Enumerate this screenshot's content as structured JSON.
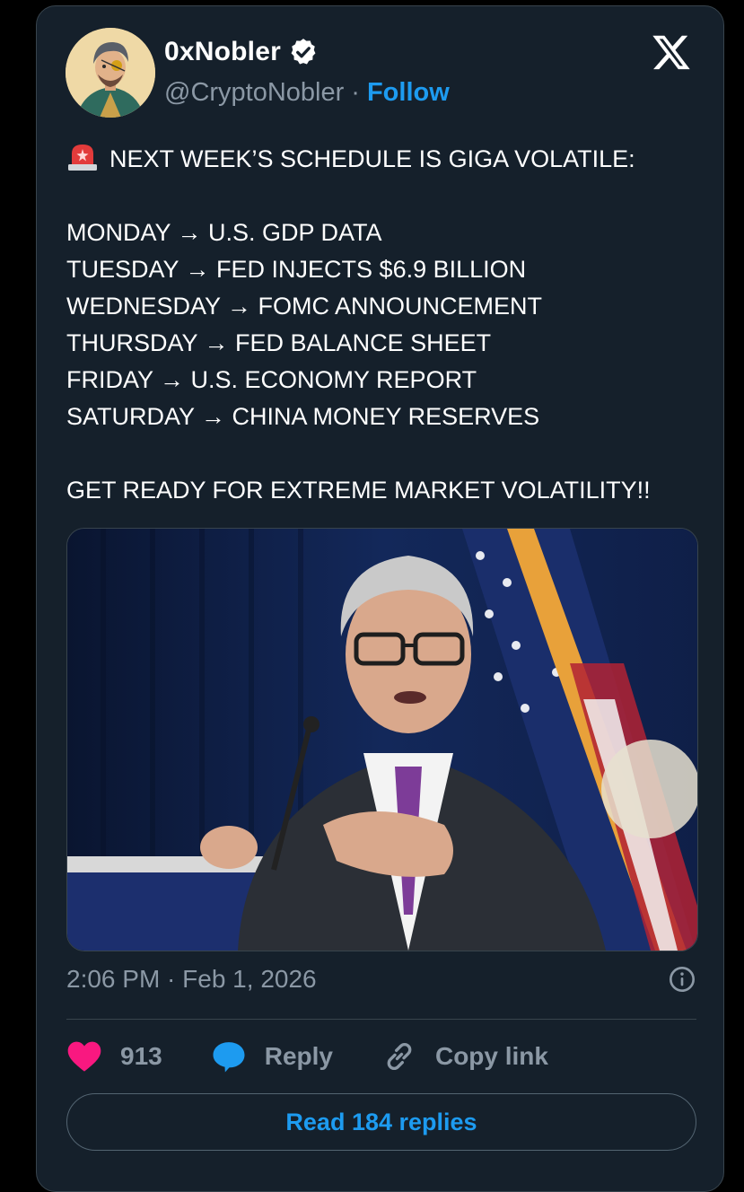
{
  "author": {
    "display_name": "0xNobler",
    "handle": "@CryptoNobler",
    "separator": "·",
    "follow_label": "Follow",
    "verified": true
  },
  "tweet": {
    "headline": "NEXT WEEK’S SCHEDULE IS GIGA VOLATILE:",
    "schedule": [
      "MONDAY → U.S. GDP DATA",
      "TUESDAY → FED INJECTS $6.9 BILLION",
      "WEDNESDAY → FOMC ANNOUNCEMENT",
      "THURSDAY → FED BALANCE SHEET",
      "FRIDAY → U.S. ECONOMY REPORT",
      "SATURDAY → CHINA MONEY RESERVES"
    ],
    "closing": "GET READY FOR EXTREME MARKET VOLATILITY!!",
    "timestamp": "2:06 PM · Feb 1, 2026"
  },
  "actions": {
    "likes_count": "913",
    "reply_label": "Reply",
    "copy_link_label": "Copy link",
    "read_replies_label": "Read 184 replies"
  },
  "icons": {
    "logo": "x-logo-icon",
    "verified": "verified-badge-icon",
    "siren": "siren-emoji-icon",
    "info": "info-icon",
    "like": "heart-icon",
    "reply": "speech-bubble-icon",
    "copy": "link-icon"
  },
  "colors": {
    "background": "#15202b",
    "accent": "#1d9bf0",
    "like": "#f91880",
    "muted_text": "#8b98a5",
    "border": "#38444d"
  }
}
